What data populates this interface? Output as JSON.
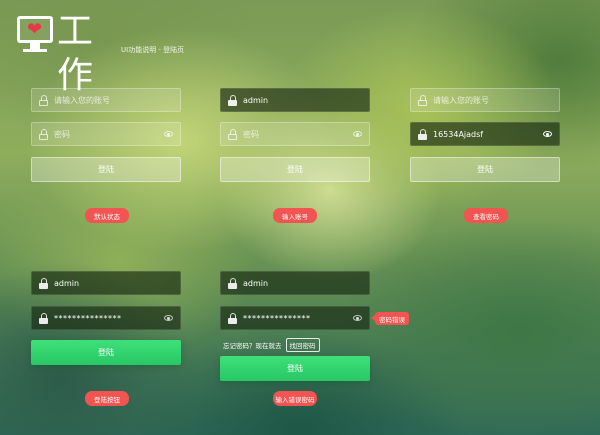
{
  "header": {
    "logo_text": "工作",
    "subtitle": "UI功能说明 - 登陆页"
  },
  "columns": [
    {
      "username": {
        "value": "",
        "placeholder": "请输入您的账号"
      },
      "password": {
        "value": "",
        "placeholder": "密码"
      },
      "button_label": "登陆",
      "tag_label": "默认状态"
    },
    {
      "username": {
        "value": "admin",
        "placeholder": ""
      },
      "password": {
        "value": "",
        "placeholder": "密码"
      },
      "button_label": "登陆",
      "tag_label": "输入账号"
    },
    {
      "username": {
        "value": "",
        "placeholder": "请输入您的账号"
      },
      "password": {
        "value": "16534Ajadsf",
        "placeholder": ""
      },
      "button_label": "登陆",
      "tag_label": "查看密码"
    },
    {
      "username": {
        "value": "admin",
        "placeholder": ""
      },
      "password": {
        "value": "***************",
        "placeholder": ""
      },
      "button_label": "登陆",
      "tag_label": "登陆按钮"
    },
    {
      "username": {
        "value": "admin",
        "placeholder": ""
      },
      "password": {
        "value": "***************",
        "placeholder": ""
      },
      "button_label": "登陆",
      "tag_label": "输入错误密码",
      "error_tip": "密码错误",
      "forgot_text": "忘记密码？现在就去",
      "forgot_link": "找回密码"
    }
  ],
  "colors": {
    "accent_green": "#2bd36b",
    "tag_red": "#f15451",
    "heart_red": "#e8374a"
  },
  "icons": [
    "monitor-heart-icon",
    "lock-icon",
    "eye-icon"
  ]
}
